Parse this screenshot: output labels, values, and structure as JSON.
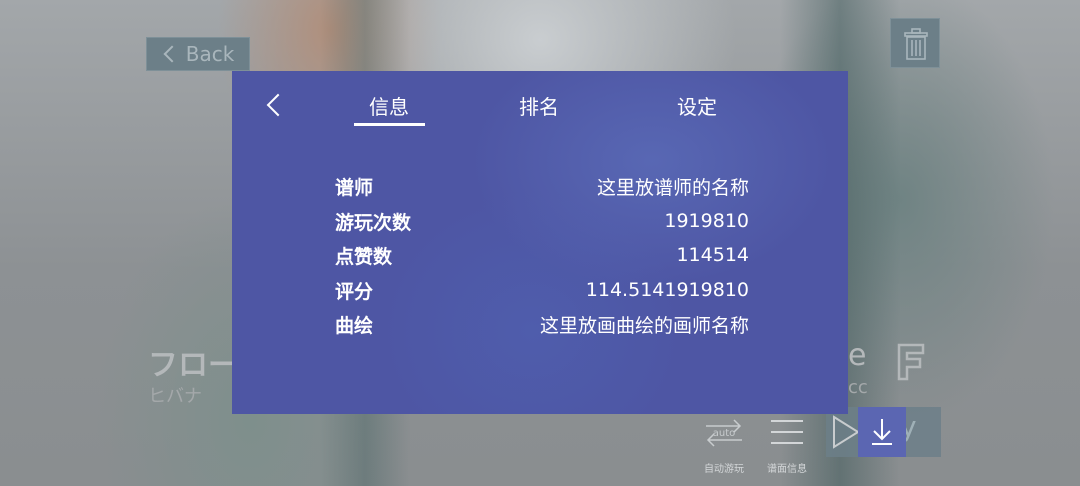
{
  "header": {
    "back_label": "Back"
  },
  "song": {
    "title": "フロー",
    "artist": "ヒバナ",
    "right_title": "e",
    "right_sub": "cc",
    "rank": "F"
  },
  "bottom": {
    "auto_label": "自动游玩",
    "chartinfo_label": "谱面信息",
    "auto_icon_text": "auto",
    "play_fragment": "y"
  },
  "modal": {
    "tabs": [
      {
        "label": "信息"
      },
      {
        "label": "排名"
      },
      {
        "label": "设定"
      }
    ],
    "active_tab": "信息",
    "rows": [
      {
        "key": "谱师",
        "value": "这里放谱师的名称"
      },
      {
        "key": "游玩次数",
        "value": "1919810"
      },
      {
        "key": "点赞数",
        "value": "114514"
      },
      {
        "key": "评分",
        "value": "114.5141919810"
      },
      {
        "key": "曲绘",
        "value": "这里放画曲绘的画师名称"
      }
    ]
  },
  "colors": {
    "modal_bg": "#4e56a4",
    "button_bg": "#6c7f88",
    "download_bg": "#5b66b2"
  }
}
